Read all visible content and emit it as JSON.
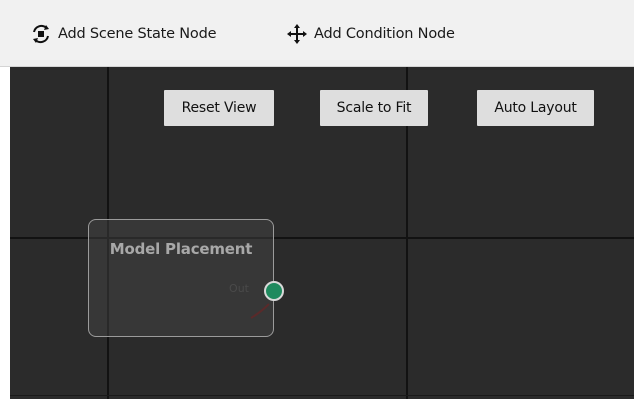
{
  "toolbar": {
    "add_scene_state_label": "Add Scene State Node",
    "add_scene_state_icon": "scene-state-icon",
    "add_condition_label": "Add Condition Node",
    "add_condition_icon": "move-arrows-icon"
  },
  "canvas": {
    "background": "#2b2b2b",
    "buttons": {
      "reset_view": "Reset View",
      "scale_to_fit": "Scale to Fit",
      "auto_layout": "Auto Layout"
    },
    "node": {
      "title": "Model Placement",
      "port_label": "Out",
      "port_color": "#1f8a5e"
    }
  }
}
